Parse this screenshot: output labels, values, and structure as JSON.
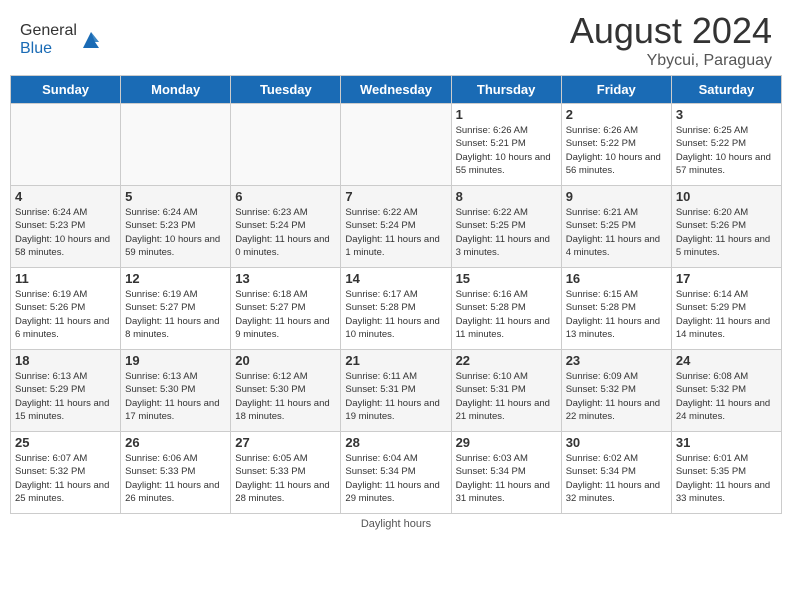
{
  "header": {
    "logo_general": "General",
    "logo_blue": "Blue",
    "month_year": "August 2024",
    "location": "Ybycui, Paraguay"
  },
  "footer": {
    "daylight_label": "Daylight hours"
  },
  "calendar": {
    "headers": [
      "Sunday",
      "Monday",
      "Tuesday",
      "Wednesday",
      "Thursday",
      "Friday",
      "Saturday"
    ],
    "weeks": [
      [
        {
          "day": "",
          "info": ""
        },
        {
          "day": "",
          "info": ""
        },
        {
          "day": "",
          "info": ""
        },
        {
          "day": "",
          "info": ""
        },
        {
          "day": "1",
          "info": "Sunrise: 6:26 AM\nSunset: 5:21 PM\nDaylight: 10 hours and 55 minutes."
        },
        {
          "day": "2",
          "info": "Sunrise: 6:26 AM\nSunset: 5:22 PM\nDaylight: 10 hours and 56 minutes."
        },
        {
          "day": "3",
          "info": "Sunrise: 6:25 AM\nSunset: 5:22 PM\nDaylight: 10 hours and 57 minutes."
        }
      ],
      [
        {
          "day": "4",
          "info": "Sunrise: 6:24 AM\nSunset: 5:23 PM\nDaylight: 10 hours and 58 minutes."
        },
        {
          "day": "5",
          "info": "Sunrise: 6:24 AM\nSunset: 5:23 PM\nDaylight: 10 hours and 59 minutes."
        },
        {
          "day": "6",
          "info": "Sunrise: 6:23 AM\nSunset: 5:24 PM\nDaylight: 11 hours and 0 minutes."
        },
        {
          "day": "7",
          "info": "Sunrise: 6:22 AM\nSunset: 5:24 PM\nDaylight: 11 hours and 1 minute."
        },
        {
          "day": "8",
          "info": "Sunrise: 6:22 AM\nSunset: 5:25 PM\nDaylight: 11 hours and 3 minutes."
        },
        {
          "day": "9",
          "info": "Sunrise: 6:21 AM\nSunset: 5:25 PM\nDaylight: 11 hours and 4 minutes."
        },
        {
          "day": "10",
          "info": "Sunrise: 6:20 AM\nSunset: 5:26 PM\nDaylight: 11 hours and 5 minutes."
        }
      ],
      [
        {
          "day": "11",
          "info": "Sunrise: 6:19 AM\nSunset: 5:26 PM\nDaylight: 11 hours and 6 minutes."
        },
        {
          "day": "12",
          "info": "Sunrise: 6:19 AM\nSunset: 5:27 PM\nDaylight: 11 hours and 8 minutes."
        },
        {
          "day": "13",
          "info": "Sunrise: 6:18 AM\nSunset: 5:27 PM\nDaylight: 11 hours and 9 minutes."
        },
        {
          "day": "14",
          "info": "Sunrise: 6:17 AM\nSunset: 5:28 PM\nDaylight: 11 hours and 10 minutes."
        },
        {
          "day": "15",
          "info": "Sunrise: 6:16 AM\nSunset: 5:28 PM\nDaylight: 11 hours and 11 minutes."
        },
        {
          "day": "16",
          "info": "Sunrise: 6:15 AM\nSunset: 5:28 PM\nDaylight: 11 hours and 13 minutes."
        },
        {
          "day": "17",
          "info": "Sunrise: 6:14 AM\nSunset: 5:29 PM\nDaylight: 11 hours and 14 minutes."
        }
      ],
      [
        {
          "day": "18",
          "info": "Sunrise: 6:13 AM\nSunset: 5:29 PM\nDaylight: 11 hours and 15 minutes."
        },
        {
          "day": "19",
          "info": "Sunrise: 6:13 AM\nSunset: 5:30 PM\nDaylight: 11 hours and 17 minutes."
        },
        {
          "day": "20",
          "info": "Sunrise: 6:12 AM\nSunset: 5:30 PM\nDaylight: 11 hours and 18 minutes."
        },
        {
          "day": "21",
          "info": "Sunrise: 6:11 AM\nSunset: 5:31 PM\nDaylight: 11 hours and 19 minutes."
        },
        {
          "day": "22",
          "info": "Sunrise: 6:10 AM\nSunset: 5:31 PM\nDaylight: 11 hours and 21 minutes."
        },
        {
          "day": "23",
          "info": "Sunrise: 6:09 AM\nSunset: 5:32 PM\nDaylight: 11 hours and 22 minutes."
        },
        {
          "day": "24",
          "info": "Sunrise: 6:08 AM\nSunset: 5:32 PM\nDaylight: 11 hours and 24 minutes."
        }
      ],
      [
        {
          "day": "25",
          "info": "Sunrise: 6:07 AM\nSunset: 5:32 PM\nDaylight: 11 hours and 25 minutes."
        },
        {
          "day": "26",
          "info": "Sunrise: 6:06 AM\nSunset: 5:33 PM\nDaylight: 11 hours and 26 minutes."
        },
        {
          "day": "27",
          "info": "Sunrise: 6:05 AM\nSunset: 5:33 PM\nDaylight: 11 hours and 28 minutes."
        },
        {
          "day": "28",
          "info": "Sunrise: 6:04 AM\nSunset: 5:34 PM\nDaylight: 11 hours and 29 minutes."
        },
        {
          "day": "29",
          "info": "Sunrise: 6:03 AM\nSunset: 5:34 PM\nDaylight: 11 hours and 31 minutes."
        },
        {
          "day": "30",
          "info": "Sunrise: 6:02 AM\nSunset: 5:34 PM\nDaylight: 11 hours and 32 minutes."
        },
        {
          "day": "31",
          "info": "Sunrise: 6:01 AM\nSunset: 5:35 PM\nDaylight: 11 hours and 33 minutes."
        }
      ]
    ]
  }
}
